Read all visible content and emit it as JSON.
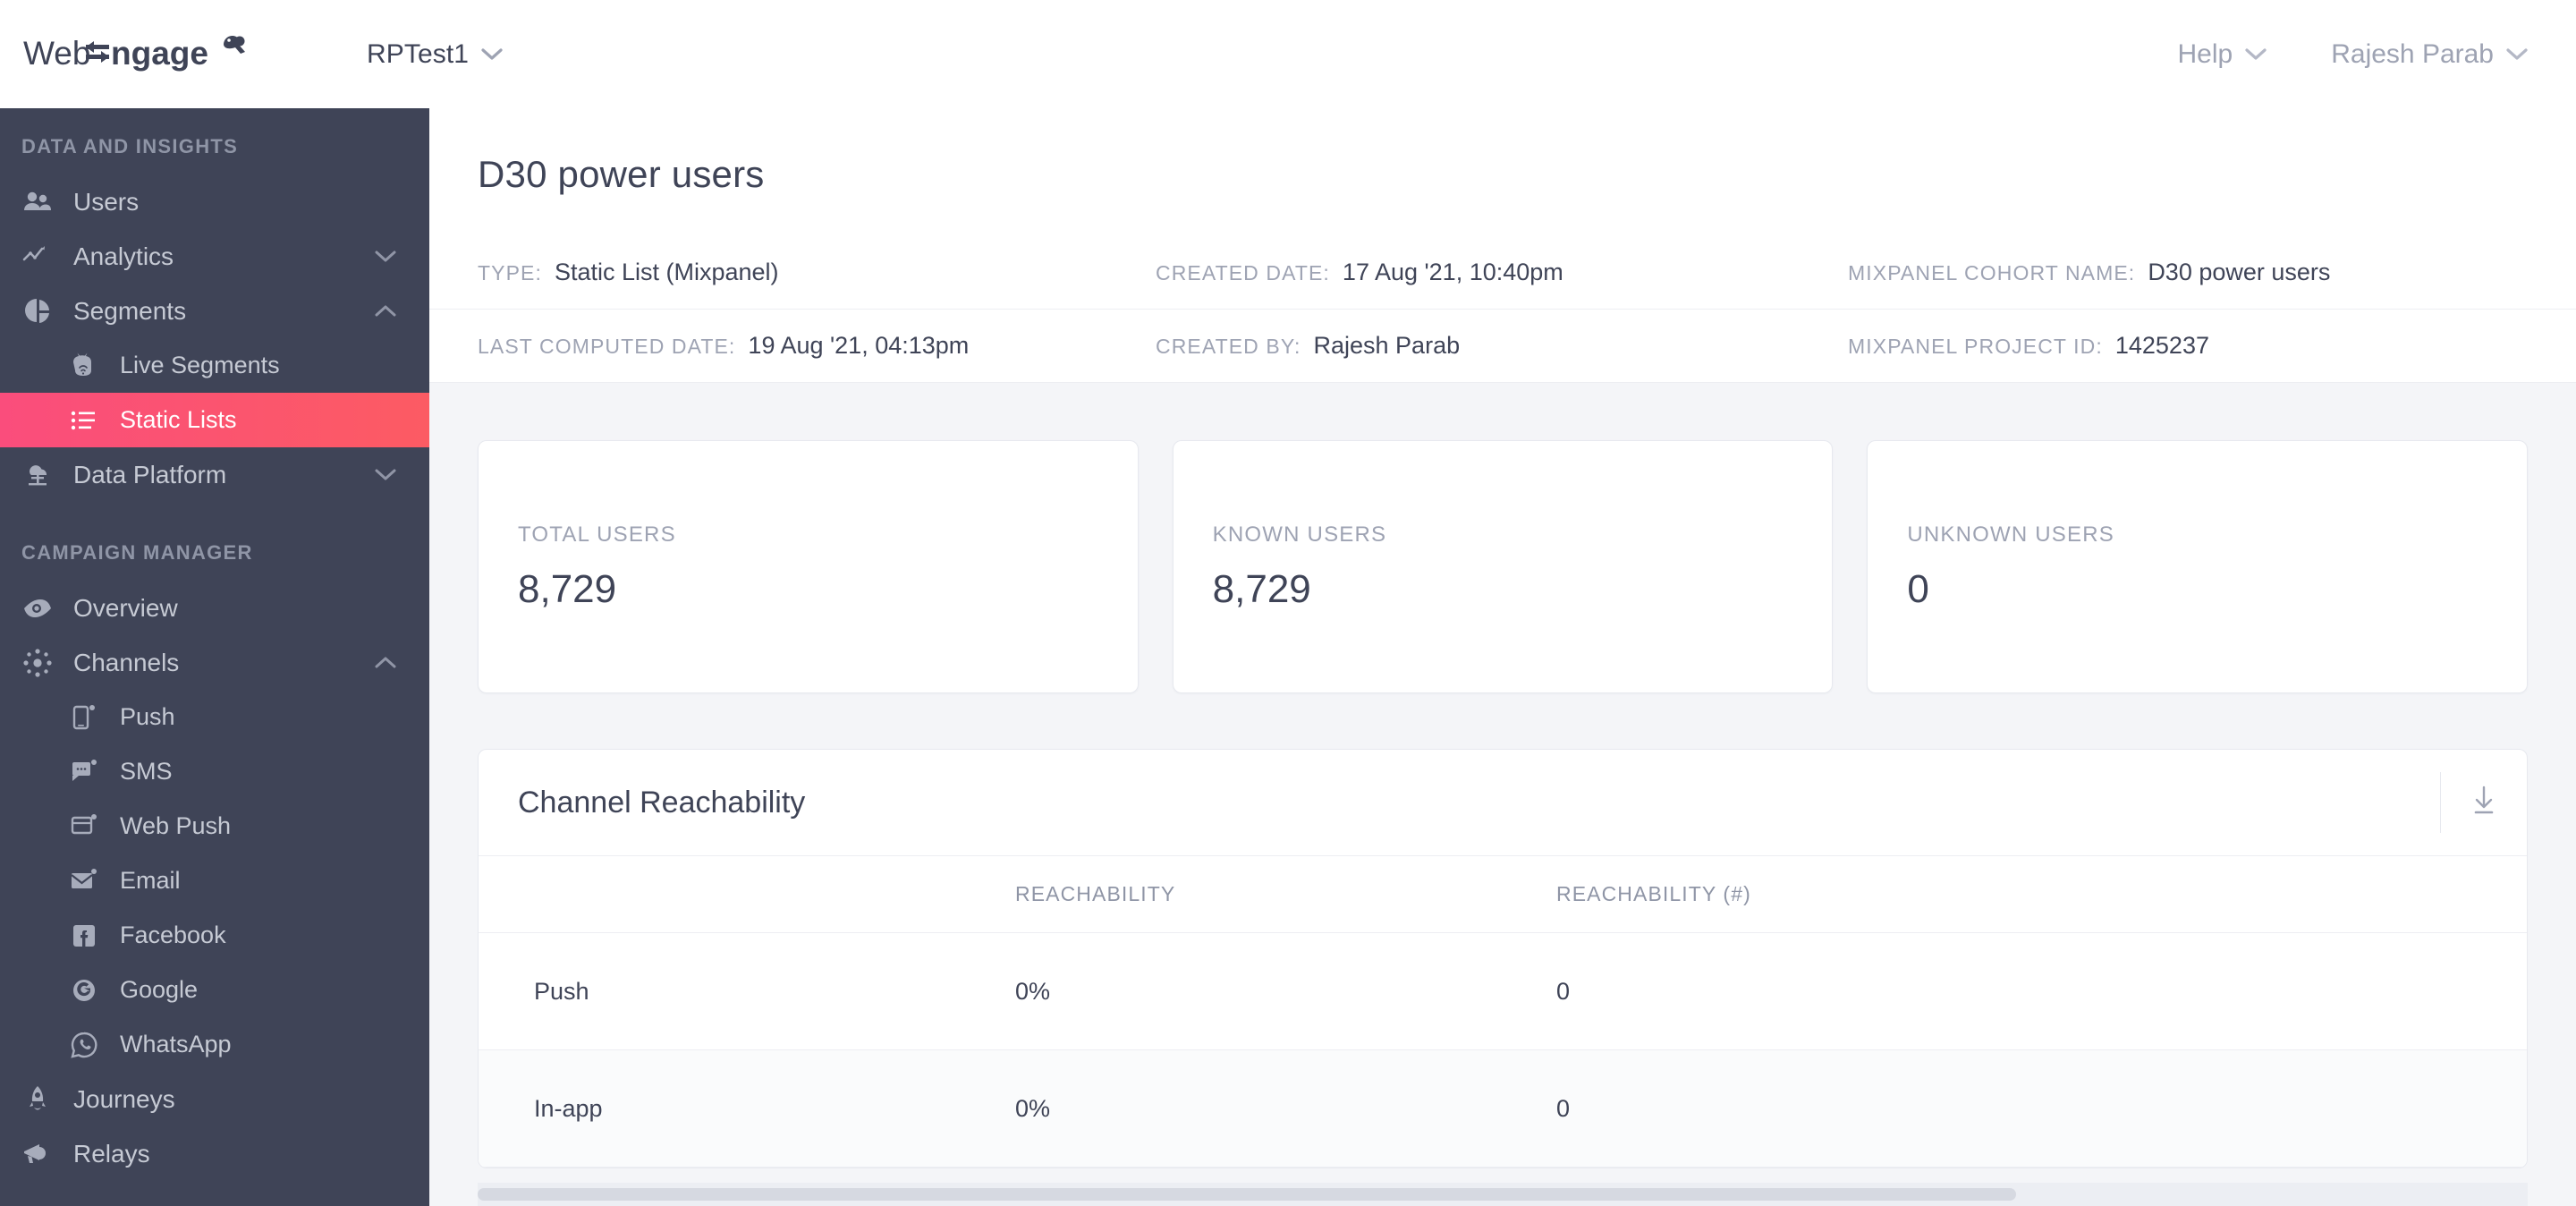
{
  "topbar": {
    "logo_text": "WebEngage",
    "project": "RPTest1",
    "help": "Help",
    "user": "Rajesh Parab",
    "chevron_icon": "chevron-down-icon"
  },
  "sidebar": {
    "sections": [
      {
        "title": "DATA AND INSIGHTS",
        "items": [
          {
            "label": "Users",
            "icon": "users-icon",
            "active": false,
            "sub": false,
            "caret": ""
          },
          {
            "label": "Analytics",
            "icon": "analytics-line-icon",
            "active": false,
            "sub": false,
            "caret": "down"
          },
          {
            "label": "Segments",
            "icon": "pie-chart-icon",
            "active": false,
            "sub": false,
            "caret": "up"
          },
          {
            "label": "Live Segments",
            "icon": "live-segments-icon",
            "active": false,
            "sub": true,
            "caret": ""
          },
          {
            "label": "Static Lists",
            "icon": "list-icon",
            "active": true,
            "sub": true,
            "caret": ""
          },
          {
            "label": "Data Platform",
            "icon": "cloud-data-icon",
            "active": false,
            "sub": false,
            "caret": "down"
          }
        ]
      },
      {
        "title": "CAMPAIGN MANAGER",
        "items": [
          {
            "label": "Overview",
            "icon": "eye-icon",
            "active": false,
            "sub": false,
            "caret": ""
          },
          {
            "label": "Channels",
            "icon": "channels-icon",
            "active": false,
            "sub": false,
            "caret": "up"
          },
          {
            "label": "Push",
            "icon": "push-phone-icon",
            "active": false,
            "sub": true,
            "caret": ""
          },
          {
            "label": "SMS",
            "icon": "sms-bubble-icon",
            "active": false,
            "sub": true,
            "caret": ""
          },
          {
            "label": "Web Push",
            "icon": "web-push-icon",
            "active": false,
            "sub": true,
            "caret": ""
          },
          {
            "label": "Email",
            "icon": "email-envelope-icon",
            "active": false,
            "sub": true,
            "caret": ""
          },
          {
            "label": "Facebook",
            "icon": "facebook-icon",
            "active": false,
            "sub": true,
            "caret": ""
          },
          {
            "label": "Google",
            "icon": "google-icon",
            "active": false,
            "sub": true,
            "caret": ""
          },
          {
            "label": "WhatsApp",
            "icon": "whatsapp-icon",
            "active": false,
            "sub": true,
            "caret": ""
          },
          {
            "label": "Journeys",
            "icon": "rocket-icon",
            "active": false,
            "sub": false,
            "caret": ""
          },
          {
            "label": "Relays",
            "icon": "megaphone-icon",
            "active": false,
            "sub": false,
            "caret": ""
          }
        ]
      }
    ],
    "active_gradient_from": "#fa4d7c",
    "active_gradient_to": "#fc5b63",
    "background": "#3f4457"
  },
  "page": {
    "title": "D30 power users",
    "meta": [
      [
        {
          "key": "TYPE:",
          "value": "Static List (Mixpanel)"
        },
        {
          "key": "CREATED DATE:",
          "value": "17 Aug '21, 10:40pm"
        },
        {
          "key": "MIXPANEL COHORT NAME:",
          "value": "D30 power users"
        }
      ],
      [
        {
          "key": "LAST COMPUTED DATE:",
          "value": "19 Aug '21, 04:13pm"
        },
        {
          "key": "CREATED BY:",
          "value": "Rajesh Parab"
        },
        {
          "key": "MIXPANEL PROJECT ID:",
          "value": "1425237"
        }
      ]
    ]
  },
  "cards": [
    {
      "label": "TOTAL USERS",
      "value": "8,729"
    },
    {
      "label": "KNOWN USERS",
      "value": "8,729"
    },
    {
      "label": "UNKNOWN USERS",
      "value": "0"
    }
  ],
  "panel": {
    "title": "Channel Reachability",
    "download_icon": "download-icon",
    "columns": [
      "",
      "REACHABILITY",
      "REACHABILITY (#)"
    ],
    "rows": [
      {
        "name": "Push",
        "reachability": "0%",
        "reachability_n": "0"
      },
      {
        "name": "In-app",
        "reachability": "0%",
        "reachability_n": "0"
      }
    ]
  }
}
